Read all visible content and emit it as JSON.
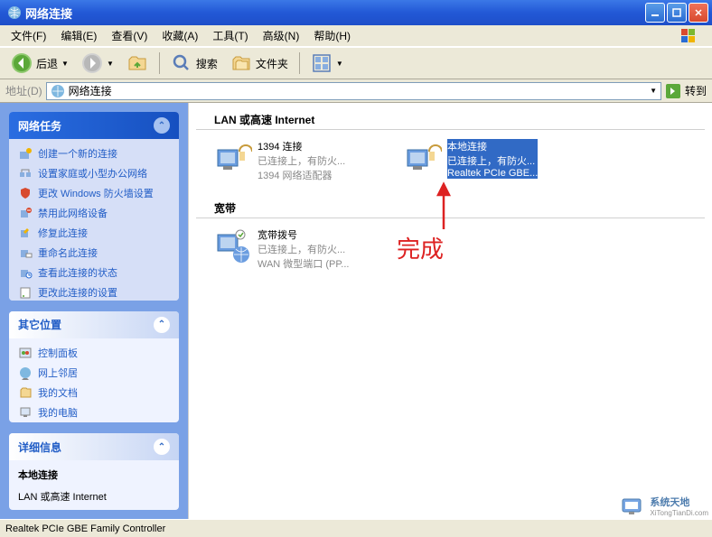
{
  "window": {
    "title": "网络连接"
  },
  "menu": {
    "file": "文件(F)",
    "edit": "编辑(E)",
    "view": "查看(V)",
    "favorites": "收藏(A)",
    "tools": "工具(T)",
    "advanced": "高级(N)",
    "help": "帮助(H)"
  },
  "toolbar": {
    "back": "后退",
    "search": "搜索",
    "folders": "文件夹"
  },
  "addressbar": {
    "label": "地址(D)",
    "value": "网络连接",
    "go": "转到"
  },
  "sidebar": {
    "tasks": {
      "title": "网络任务",
      "items": [
        "创建一个新的连接",
        "设置家庭或小型办公网络",
        "更改 Windows 防火墙设置",
        "禁用此网络设备",
        "修复此连接",
        "重命名此连接",
        "查看此连接的状态",
        "更改此连接的设置"
      ]
    },
    "other": {
      "title": "其它位置",
      "items": [
        "控制面板",
        "网上邻居",
        "我的文档",
        "我的电脑"
      ]
    },
    "details": {
      "title": "详细信息",
      "name": "本地连接",
      "type": "LAN 或高速 Internet"
    }
  },
  "groups": {
    "lan": {
      "title": "LAN 或高速 Internet",
      "conn1": {
        "name": "1394 连接",
        "status": "已连接上，有防火...",
        "device": "1394 网络适配器"
      },
      "conn2": {
        "name": "本地连接",
        "status": "已连接上，有防火...",
        "device": "Realtek PCIe GBE..."
      }
    },
    "broadband": {
      "title": "宽带",
      "conn1": {
        "name": "宽带拨号",
        "status": "已连接上，有防火...",
        "device": "WAN 微型端口 (PP..."
      }
    }
  },
  "annotation": {
    "text": "完成"
  },
  "statusbar": {
    "text": "Realtek PCIe GBE Family Controller"
  },
  "watermark": {
    "text": "系统天地",
    "url": "XiTongTianDi.com"
  }
}
